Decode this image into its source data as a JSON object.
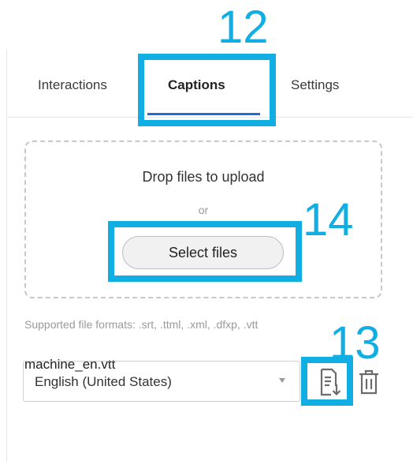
{
  "tabs": {
    "interactions": "Interactions",
    "captions": "Captions",
    "settings": "Settings"
  },
  "upload": {
    "drop_title": "Drop files to upload",
    "or_text": "or",
    "select_button": "Select files",
    "formats": "Supported file formats: .srt, .ttml, .xml, .dfxp, .vtt"
  },
  "caption": {
    "filename": "machine_en.vtt",
    "language": "English (United States)",
    "download_icon": "caption-download-icon",
    "delete_icon": "trash-icon"
  },
  "annotations": {
    "captions_tab": "12",
    "download": "13",
    "select_files": "14"
  },
  "colors": {
    "accent": "#1e6fd9",
    "annotation": "#10aee3"
  }
}
